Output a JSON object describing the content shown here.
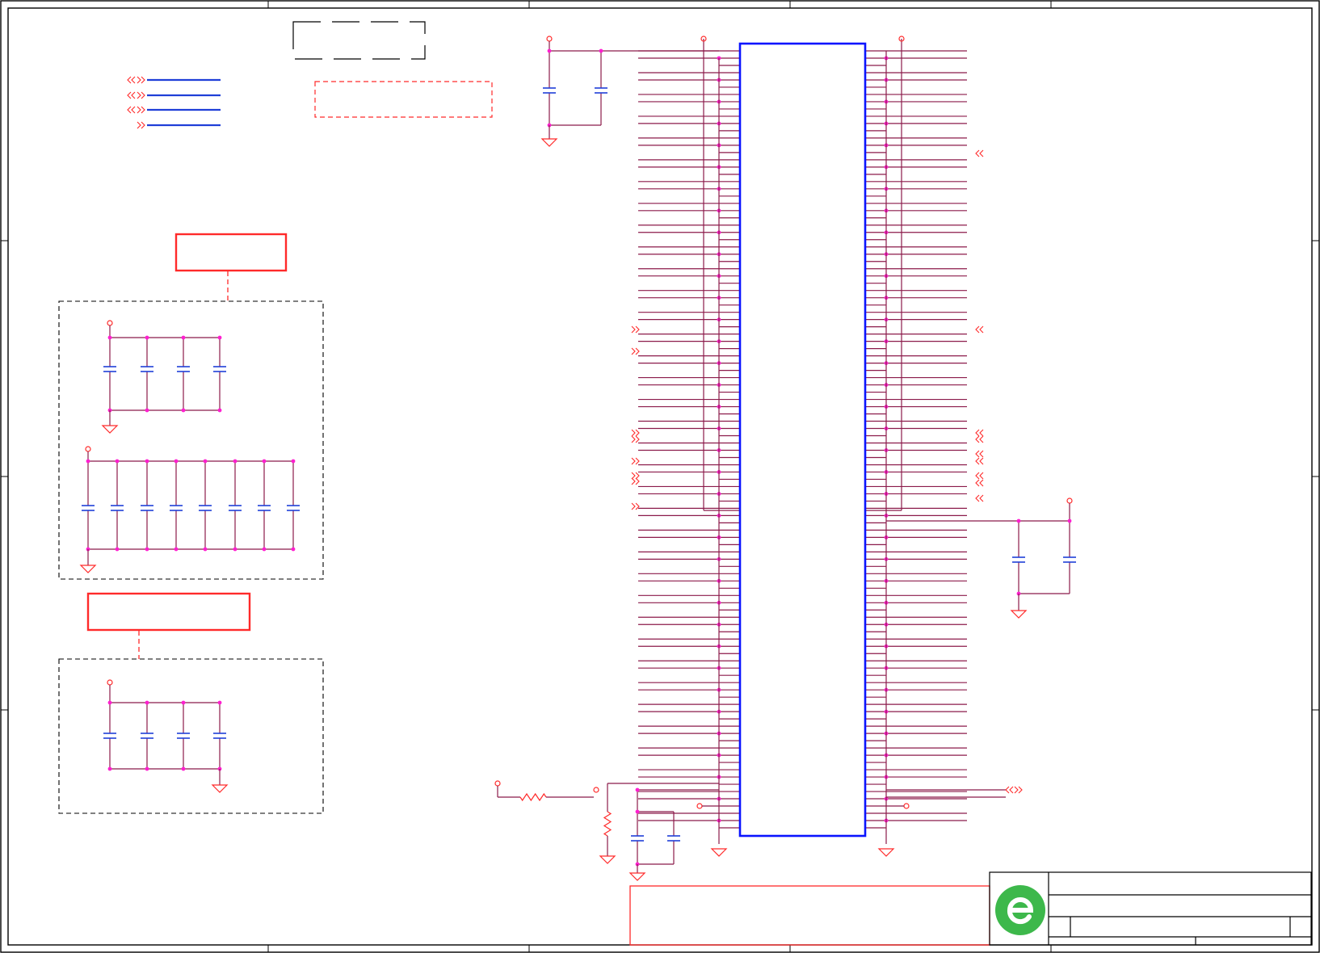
{
  "colors": {
    "wire": "#8b1a4a",
    "component_red": "#ff2a2a",
    "capacitor_blue": "#1f3fd8",
    "ic_outline": "#0a14ff",
    "junction": "#ff1fd0",
    "frame": "#000000",
    "logo_green": "#3db84b",
    "logo_white": "#ffffff"
  },
  "icons": {
    "logo": "company-logo-e-icon",
    "power": "power-pin-circle-icon",
    "ground": "ground-triangle-icon",
    "port": "off-page-connector-chevron-icon",
    "capacitor": "capacitor-icon",
    "resistor": "resistor-zigzag-icon"
  },
  "schematic": {
    "ic_left_pins": 72,
    "ic_right_pins": 72
  }
}
